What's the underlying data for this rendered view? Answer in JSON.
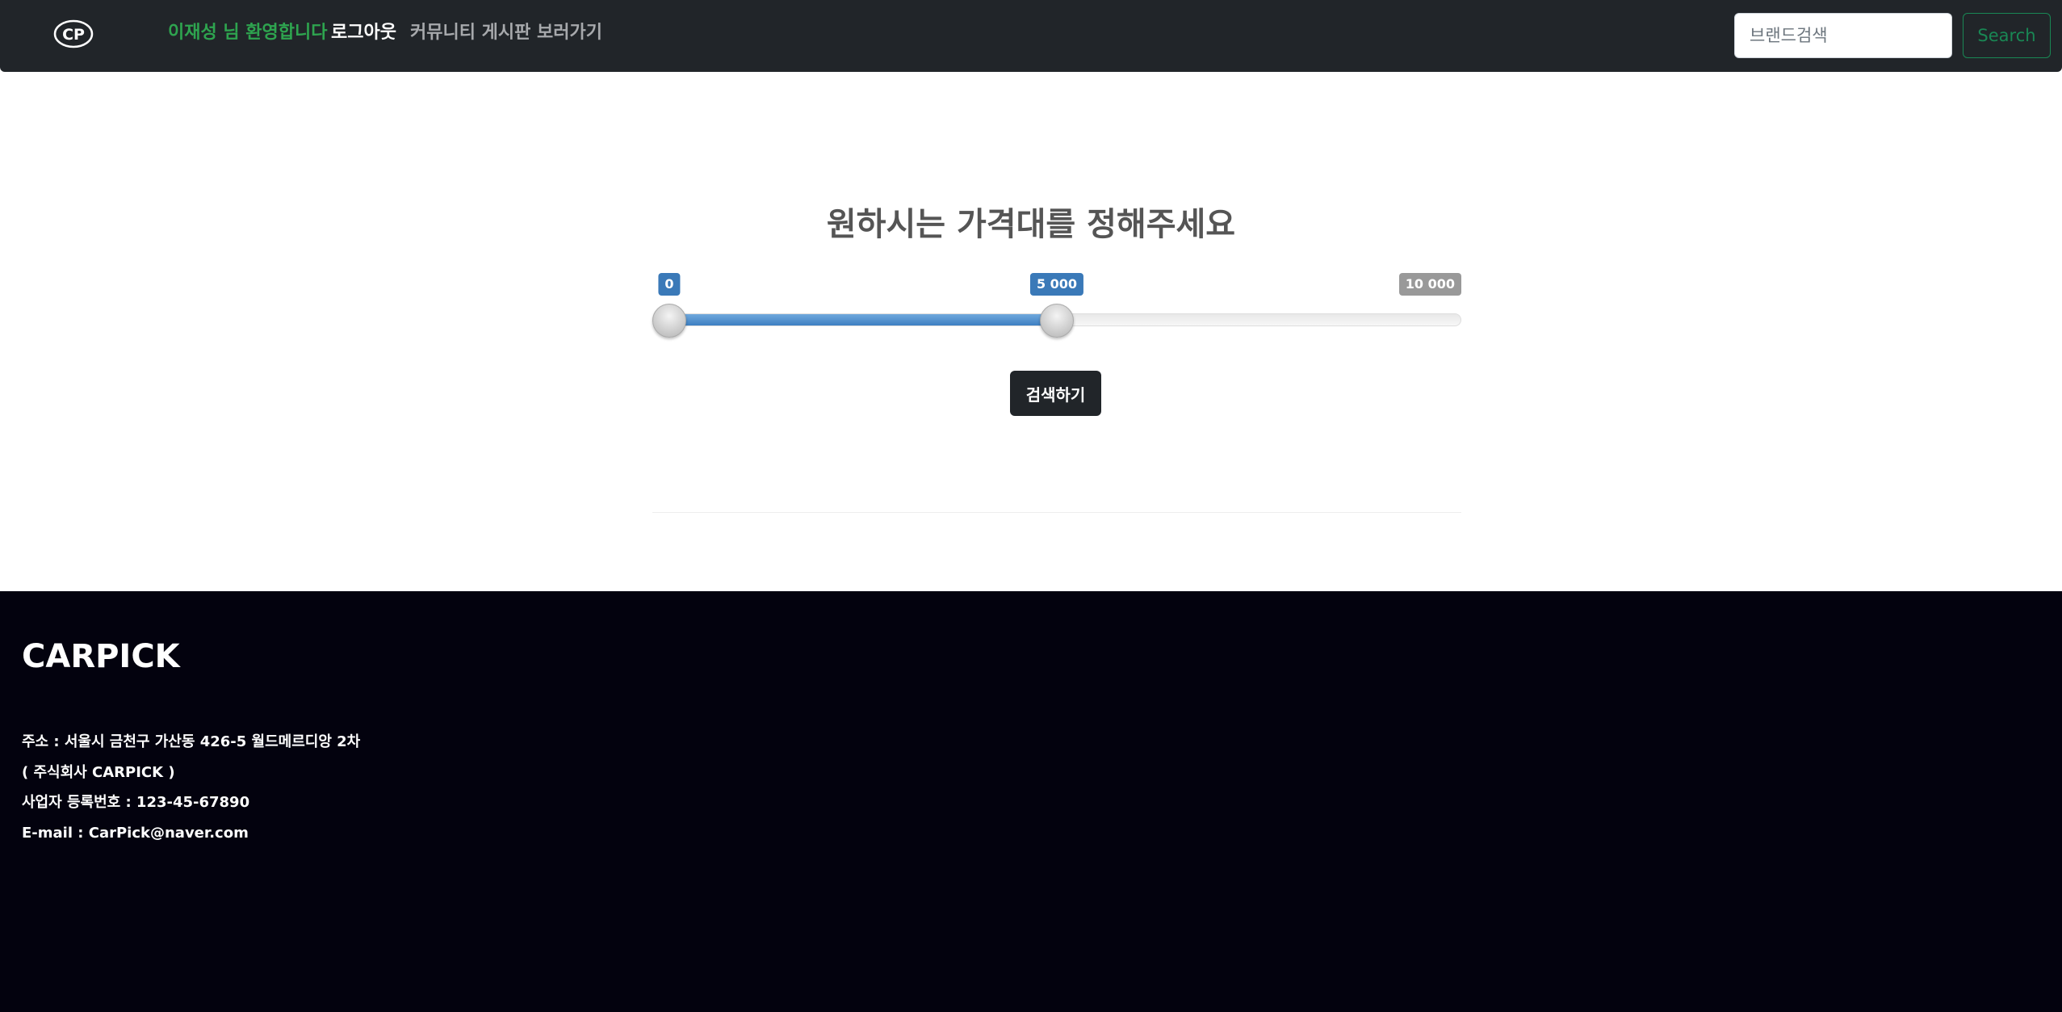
{
  "nav": {
    "logo_icon": "cp-logo-icon",
    "logo_text": "CP",
    "welcome": "이재성 님 환영합니다",
    "logout": "로그아웃",
    "community": "커뮤니티 게시판 보러가기",
    "search_placeholder": "브랜드검색",
    "search_button": "Search"
  },
  "colors": {
    "navbar_bg": "#212529",
    "welcome_text": "#2ea44f",
    "search_outline": "#198754",
    "slider_fill": "#3d7fc2",
    "footer_bg": "#03020e"
  },
  "main": {
    "title": "원하시는 가격대를 정해주세요",
    "slider": {
      "min": 0,
      "max": 10000,
      "low": 0,
      "high": 5000,
      "low_label": "0",
      "high_label": "5 000",
      "max_label": "10 000"
    },
    "search_action": "검색하기"
  },
  "footer": {
    "brand": "CARPICK",
    "address": "주소 : 서울시 금천구 가산동 426-5 월드메르디앙 2차",
    "company": "( 주식회사 CARPICK )",
    "business_number": "사업자 등록번호 : 123-45-67890",
    "email": "E-mail : CarPick@naver.com"
  }
}
